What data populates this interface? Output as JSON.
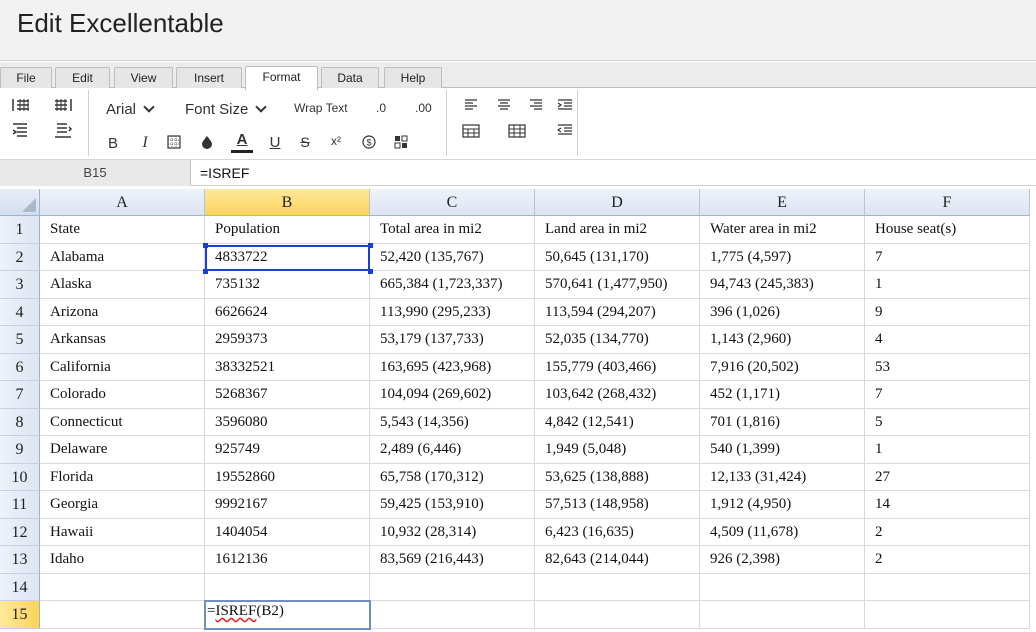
{
  "app": {
    "title": "Edit Excellentable"
  },
  "menu": {
    "tabs": [
      "File",
      "Edit",
      "View",
      "Insert",
      "Format",
      "Data",
      "Help"
    ],
    "active": "Format"
  },
  "toolbar": {
    "font_family": "Arial",
    "font_size_label": "Font Size",
    "wrap_text_label": "Wrap Text",
    "decrease_decimal_label": ".0",
    "increase_decimal_label": ".00"
  },
  "formula_bar": {
    "cell_ref": "B15",
    "formula": "=ISREF"
  },
  "grid": {
    "columns": [
      "A",
      "B",
      "C",
      "D",
      "E",
      "F"
    ],
    "selected_column": "B",
    "selected_row": "15",
    "rows": [
      {
        "num": "1",
        "cells": [
          "State",
          "Population",
          "Total area in mi2",
          "Land area in mi2",
          "Water area in mi2",
          "House seat(s)"
        ]
      },
      {
        "num": "2",
        "cells": [
          "Alabama",
          "4833722",
          "52,420 (135,767)",
          "50,645 (131,170)",
          "1,775 (4,597)",
          "7"
        ]
      },
      {
        "num": "3",
        "cells": [
          "Alaska",
          "735132",
          "665,384 (1,723,337)",
          "570,641 (1,477,950)",
          "94,743 (245,383)",
          "1"
        ]
      },
      {
        "num": "4",
        "cells": [
          "Arizona",
          "6626624",
          "113,990 (295,233)",
          "113,594 (294,207)",
          "396 (1,026)",
          "9"
        ]
      },
      {
        "num": "5",
        "cells": [
          "Arkansas",
          "2959373",
          "53,179 (137,733)",
          "52,035 (134,770)",
          "1,143 (2,960)",
          "4"
        ]
      },
      {
        "num": "6",
        "cells": [
          "California",
          "38332521",
          "163,695 (423,968)",
          "155,779 (403,466)",
          "7,916 (20,502)",
          "53"
        ]
      },
      {
        "num": "7",
        "cells": [
          "Colorado",
          "5268367",
          "104,094 (269,602)",
          "103,642 (268,432)",
          "452 (1,171)",
          "7"
        ]
      },
      {
        "num": "8",
        "cells": [
          "Connecticut",
          "3596080",
          "5,543 (14,356)",
          "4,842 (12,541)",
          "701 (1,816)",
          "5"
        ]
      },
      {
        "num": "9",
        "cells": [
          "Delaware",
          "925749",
          "2,489 (6,446)",
          "1,949 (5,048)",
          "540 (1,399)",
          "1"
        ]
      },
      {
        "num": "10",
        "cells": [
          "Florida",
          "19552860",
          "65,758 (170,312)",
          "53,625 (138,888)",
          "12,133 (31,424)",
          "27"
        ]
      },
      {
        "num": "11",
        "cells": [
          "Georgia",
          "9992167",
          "59,425 (153,910)",
          "57,513 (148,958)",
          "1,912 (4,950)",
          "14"
        ]
      },
      {
        "num": "12",
        "cells": [
          "Hawaii",
          "1404054",
          "10,932 (28,314)",
          "6,423 (16,635)",
          "4,509 (11,678)",
          "2"
        ]
      },
      {
        "num": "13",
        "cells": [
          "Idaho",
          "1612136",
          "83,569 (216,443)",
          "82,643 (214,044)",
          "926 (2,398)",
          "2"
        ]
      },
      {
        "num": "14",
        "cells": [
          "",
          "",
          "",
          "",
          "",
          ""
        ]
      },
      {
        "num": "15",
        "cells": [
          "",
          "",
          "",
          "",
          "",
          ""
        ]
      }
    ],
    "editing": {
      "prefix": "=",
      "func": "ISREF",
      "suffix": "(B2)"
    }
  },
  "colors": {
    "selection": "#1a3fd6",
    "header_selected": "#fcd35a",
    "header_bg": "#dde5f2"
  }
}
